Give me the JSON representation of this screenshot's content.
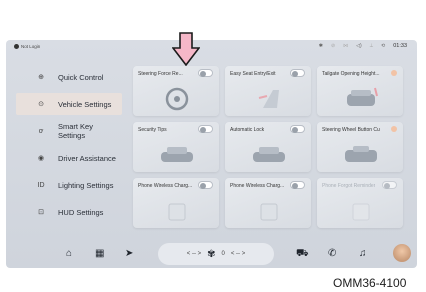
{
  "status": {
    "user": "Not Login",
    "time": "01:33"
  },
  "sidebar": {
    "items": [
      {
        "label": "Quick Control",
        "icon": "quick-control-icon",
        "glyph": "⊕"
      },
      {
        "label": "Vehicle Settings",
        "icon": "vehicle-settings-icon",
        "glyph": "⊙"
      },
      {
        "label": "Smart Key Settings",
        "icon": "key-icon",
        "glyph": "ơ"
      },
      {
        "label": "Driver Assistance",
        "icon": "driver-assist-icon",
        "glyph": "◉"
      },
      {
        "label": "Lighting Settings",
        "icon": "lighting-icon",
        "glyph": "ID"
      },
      {
        "label": "HUD Settings",
        "icon": "hud-icon",
        "glyph": "⊡"
      }
    ],
    "active_index": 1
  },
  "cards": [
    {
      "label": "Steering Force Re...",
      "control": "toggle",
      "dim": false
    },
    {
      "label": "Easy Seat Entry/Exit",
      "control": "toggle",
      "dim": false
    },
    {
      "label": "Tailgate Opening Height...",
      "control": "dot",
      "dim": false
    },
    {
      "label": "Security Tips",
      "control": "toggle",
      "dim": false
    },
    {
      "label": "Automatic Lock",
      "control": "toggle",
      "dim": false
    },
    {
      "label": "Steering Wheel Button Cu...",
      "control": "dot",
      "dim": false
    },
    {
      "label": "Phone Wireless Charg...",
      "control": "toggle",
      "dim": false
    },
    {
      "label": "Phone Wireless Charg...",
      "control": "toggle",
      "dim": false
    },
    {
      "label": "Phone Forgot Reminder",
      "control": "toggle",
      "dim": true
    }
  ],
  "dock": {
    "left_temp": "< -- >",
    "fan_level": "0",
    "right_temp": "< -- >"
  },
  "figure_code": "OMM36-4100",
  "colors": {
    "active_item_bg": "#e8e0dc",
    "arrow_fill": "#f5b7c8",
    "dot": "#f2c3a6"
  }
}
